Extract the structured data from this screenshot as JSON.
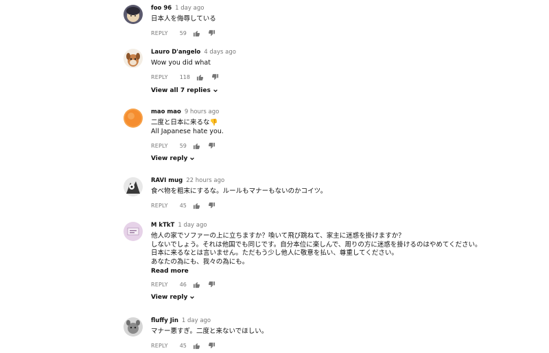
{
  "comments": [
    {
      "author": "foo 96",
      "time": "1 day ago",
      "text": [
        "日本人を侮辱している"
      ],
      "reply": "REPLY",
      "likes": "59"
    },
    {
      "author": "Lauro D'angelo",
      "time": "4 days ago",
      "text": [
        "Wow you did what"
      ],
      "reply": "REPLY",
      "likes": "118",
      "view_replies": "View all 7 replies"
    },
    {
      "author": "mao mao",
      "time": "9 hours ago",
      "text": [
        "二度と日本に来るな👎",
        "All Japanese hate you."
      ],
      "reply": "REPLY",
      "likes": "59",
      "view_replies": "View reply"
    },
    {
      "author": "RAVI mug",
      "time": "22 hours ago",
      "text": [
        "食べ物を粗末にするな。ルールもマナーもないのかコイツ。"
      ],
      "reply": "REPLY",
      "likes": "45"
    },
    {
      "author": "M kTkT",
      "time": "1 day ago",
      "text": [
        "他人の家でソファーの上に立ちますか？喚いて飛び跳ねて、家主に迷惑を掛けますか？",
        "しないでしょう。それは他国でも同じです。自分本位に楽しんで、周りの方に迷惑を掛けるのはやめてください。",
        "日本に来るなとは言いません。ただもう少し他人に敬意を払い、尊重してください。",
        "あなたの為にも、我々の為にも。"
      ],
      "read_more": "Read more",
      "reply": "REPLY",
      "likes": "46",
      "view_replies": "View reply"
    },
    {
      "author": "fluffy Jin",
      "time": "1 day ago",
      "text": [
        "マナー悪すぎ。二度と来ないでほしい。"
      ],
      "reply": "REPLY",
      "likes": "45"
    }
  ],
  "icons": {
    "like": "thumbs-up-icon",
    "dislike": "thumbs-down-icon",
    "expand": "chevron-down-icon"
  },
  "colors": {
    "text": "#111111",
    "meta": "#777777",
    "background": "#ffffff"
  }
}
